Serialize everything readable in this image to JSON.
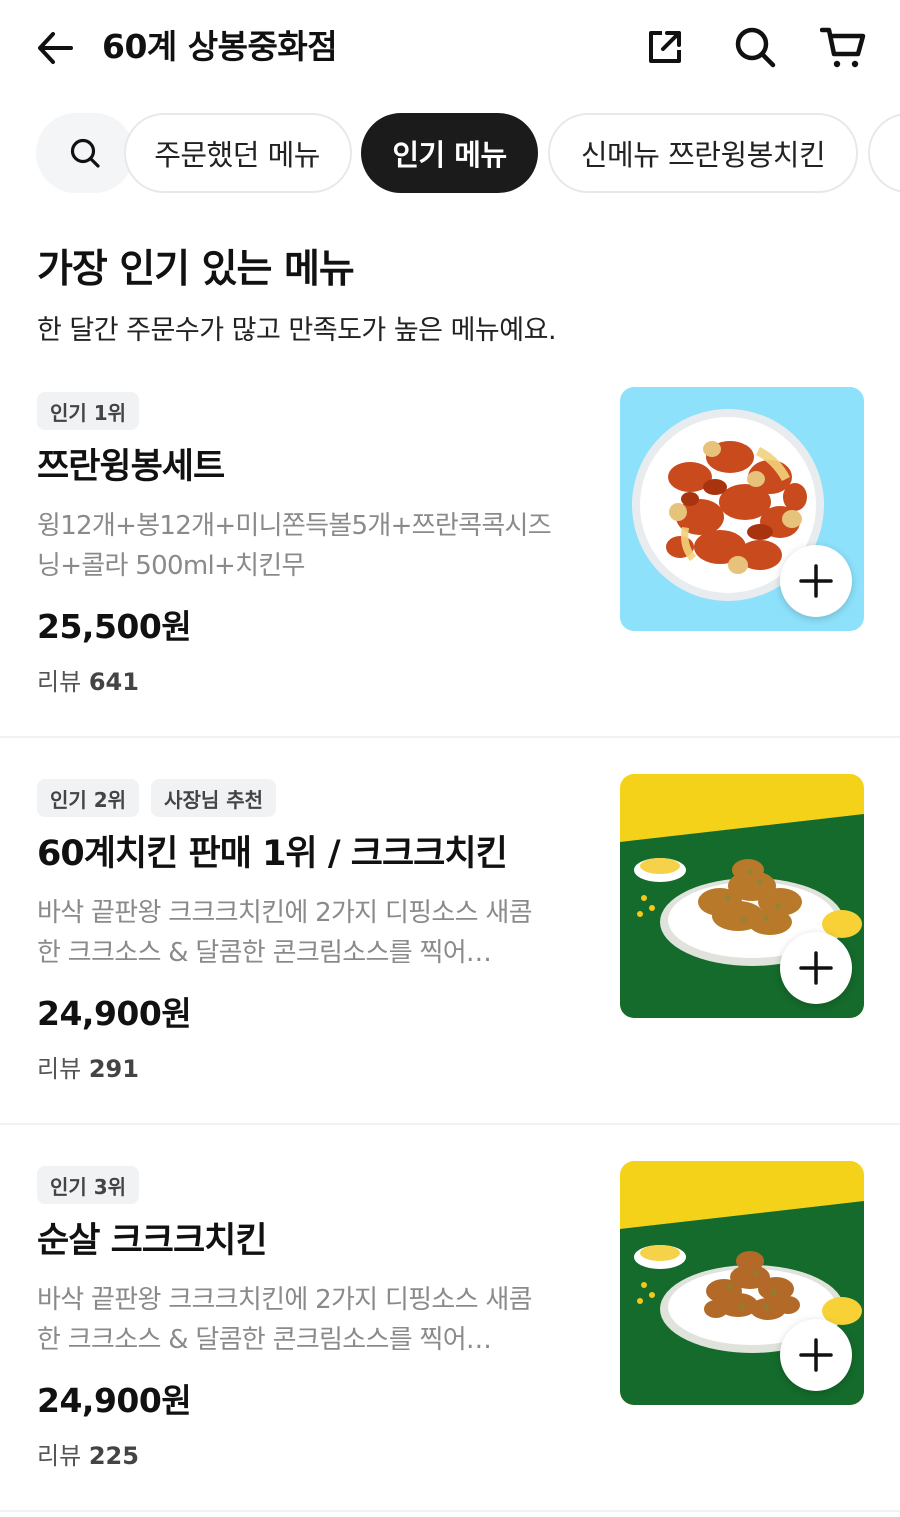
{
  "header": {
    "title": "60계 상봉중화점",
    "back_icon": "arrow-left-icon",
    "share_icon": "share-icon",
    "search_icon": "search-icon",
    "cart_icon": "cart-icon"
  },
  "categories": {
    "search_icon": "search-icon",
    "tabs": [
      {
        "label": "주문했던 메뉴",
        "active": false
      },
      {
        "label": "인기 메뉴",
        "active": true
      },
      {
        "label": "신메뉴 쯔란윙봉치킨",
        "active": false
      }
    ]
  },
  "section": {
    "title": "가장 인기 있는 메뉴",
    "subtitle": "한 달간 주문수가 많고 만족도가 높은 메뉴예요."
  },
  "items": [
    {
      "badges": [
        "인기 1위"
      ],
      "name": "쯔란윙봉세트",
      "desc_line1": "윙12개+봉12개+미니쫀득볼5개+쯔란콕콕시즈",
      "desc_line2": "닝+콜라 500ml+치킨무",
      "price": "25,500원",
      "review_label": "리뷰",
      "review_count": "641",
      "thumb_bg": "#8de1fb"
    },
    {
      "badges": [
        "인기 2위",
        "사장님 추천"
      ],
      "name": "60계치킨 판매 1위 / 크크크치킨",
      "desc_line1": "바삭 끝판왕 크크크치킨에 2가지 디핑소스 새콤",
      "desc_line2": "한 크크소스 & 달콤한 콘크림소스를 찍어…",
      "price": "24,900원",
      "review_label": "리뷰",
      "review_count": "291",
      "thumb_bg": "#f5d21a"
    },
    {
      "badges": [
        "인기 3위"
      ],
      "name": "순살 크크크치킨",
      "desc_line1": "바삭 끝판왕 크크크치킨에 2가지 디핑소스 새콤",
      "desc_line2": "한 크크소스 & 달콤한 콘크림소스를 찍어…",
      "price": "24,900원",
      "review_label": "리뷰",
      "review_count": "225",
      "thumb_bg": "#f5d21a"
    }
  ],
  "colors": {
    "accent_dark": "#1b1b1b",
    "badge_bg": "#f1f2f4",
    "desc_gray": "#8a8a8a",
    "green_bg": "#146b2c"
  },
  "add_icon": "plus-icon"
}
